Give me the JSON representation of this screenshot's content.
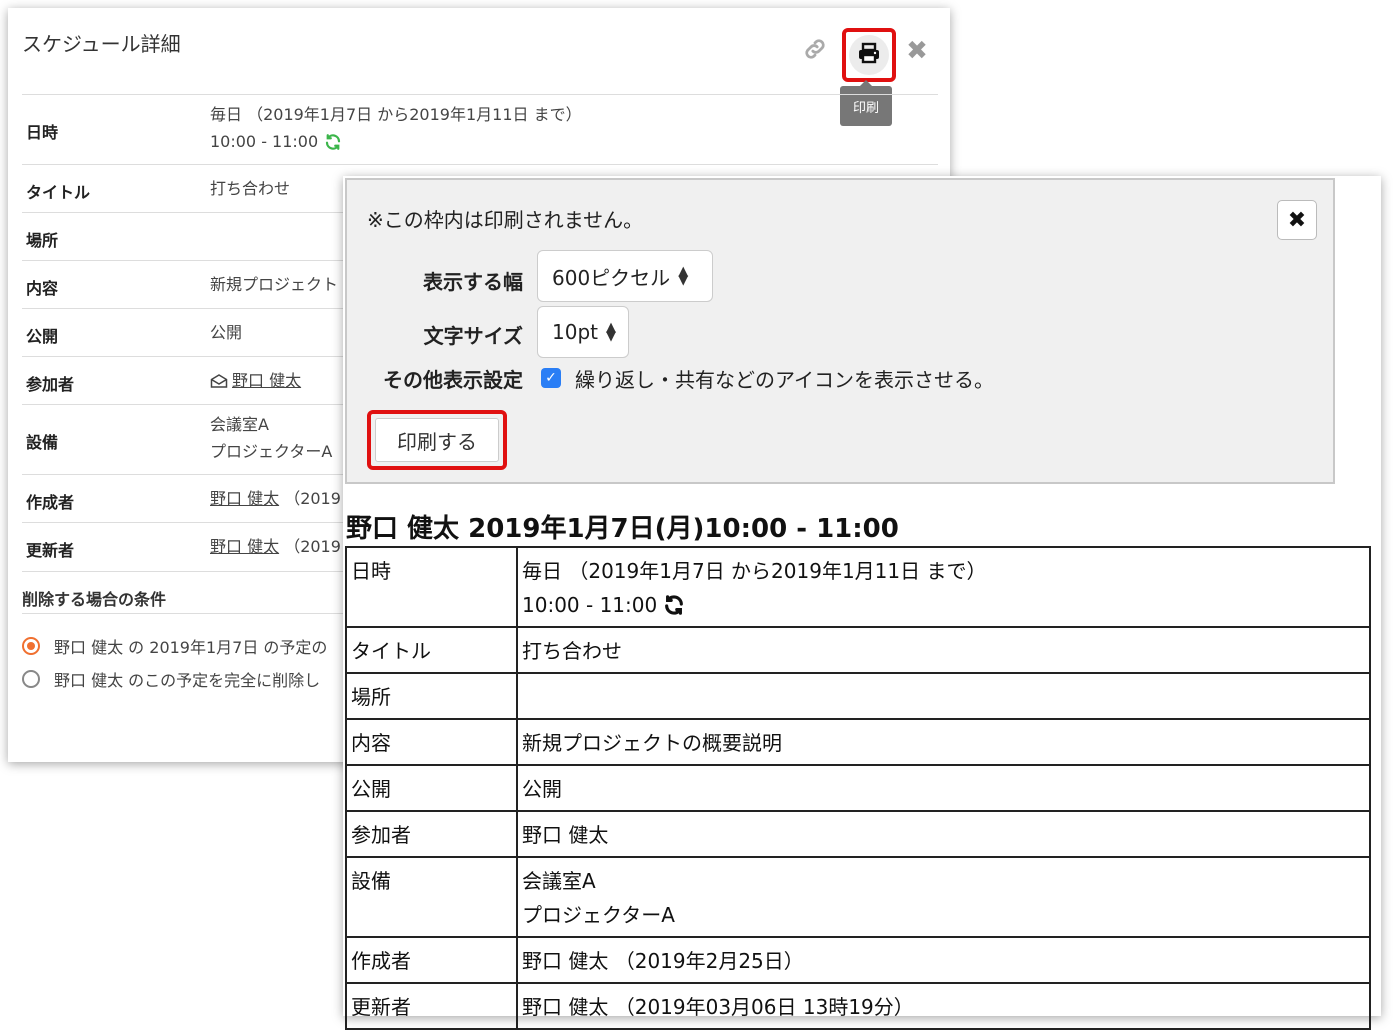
{
  "detail_dialog": {
    "title": "スケジュール詳細",
    "print_tooltip": "印刷",
    "rows": [
      {
        "label": "日時",
        "line1": "毎日 （2019年1月7日 から2019年1月11日 まで）",
        "line2": "10:00 - 11:00"
      },
      {
        "label": "タイトル",
        "value": "打ち合わせ"
      },
      {
        "label": "場所",
        "value": ""
      },
      {
        "label": "内容",
        "value": "新規プロジェクト"
      },
      {
        "label": "公開",
        "value": "公開"
      },
      {
        "label": "参加者",
        "value": "野口 健太"
      },
      {
        "label": "設備",
        "line1": "会議室A",
        "line2": "プロジェクターA"
      },
      {
        "label": "作成者",
        "name": "野口 健太",
        "suffix": "（2019"
      },
      {
        "label": "更新者",
        "name": "野口 健太",
        "suffix": "（2019"
      }
    ],
    "delete_section_title": "削除する場合の条件",
    "delete_options": [
      {
        "label": "野口 健太 の 2019年1月7日 の予定の",
        "selected": true
      },
      {
        "label": "野口 健太 のこの予定を完全に削除し",
        "selected": false
      }
    ]
  },
  "print_settings": {
    "note": "※この枠内は印刷されません。",
    "width_label": "表示する幅",
    "width_value": "600ピクセル",
    "font_label": "文字サイズ",
    "font_value": "10pt",
    "other_label": "その他表示設定",
    "other_checkbox_checked": true,
    "other_checkbox_text": "繰り返し・共有などのアイコンを表示させる。",
    "print_button": "印刷する"
  },
  "print_preview": {
    "heading": "野口 健太 2019年1月7日(月)10:00 - 11:00",
    "rows": [
      {
        "label": "日時",
        "line1": "毎日 （2019年1月7日 から2019年1月11日 まで）",
        "line2": "10:00 - 11:00"
      },
      {
        "label": "タイトル",
        "value": "打ち合わせ"
      },
      {
        "label": "場所",
        "value": ""
      },
      {
        "label": "内容",
        "value": "新規プロジェクトの概要説明"
      },
      {
        "label": "公開",
        "value": "公開"
      },
      {
        "label": "参加者",
        "value": "野口 健太"
      },
      {
        "label": "設備",
        "line1": "会議室A",
        "line2": "プロジェクターA"
      },
      {
        "label": "作成者",
        "value": "野口 健太 （2019年2月25日）"
      },
      {
        "label": "更新者",
        "value": "野口 健太 （2019年03月06日 13時19分）"
      }
    ]
  },
  "colors": {
    "highlight": "#e01010",
    "radio_selected": "#f07030",
    "checkbox": "#2a7ef5",
    "repeat_icon_green": "#3bb54a"
  }
}
